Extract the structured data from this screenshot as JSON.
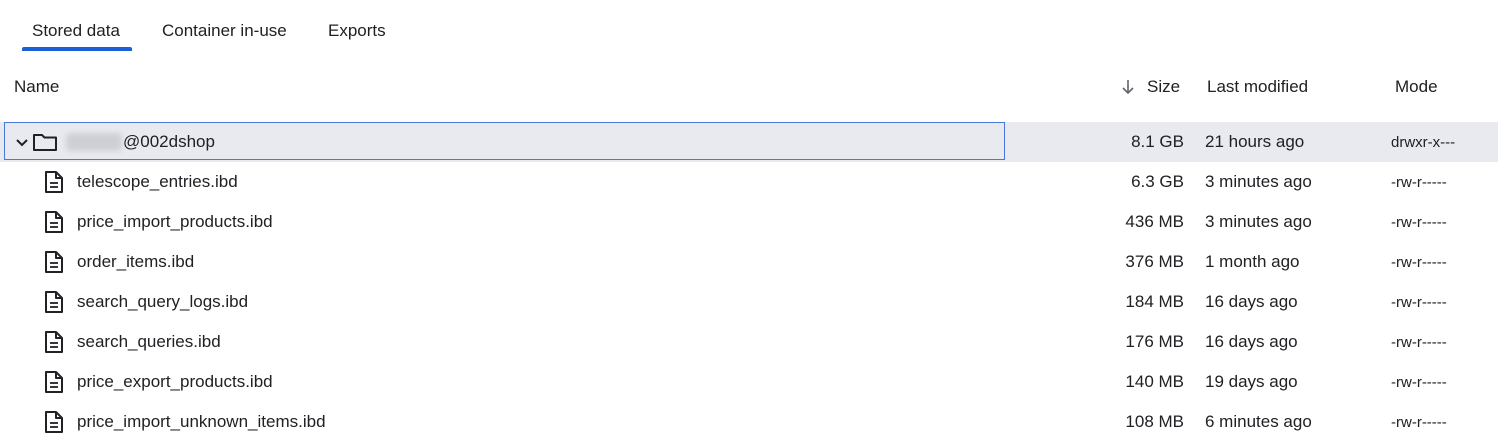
{
  "tabs": [
    {
      "label": "Stored data",
      "active": true
    },
    {
      "label": "Container in-use",
      "active": false
    },
    {
      "label": "Exports",
      "active": false
    }
  ],
  "columns": {
    "name": "Name",
    "size": "Size",
    "last_modified": "Last modified",
    "mode": "Mode"
  },
  "folder": {
    "name": "@002dshop",
    "size": "8.1 GB",
    "modified": "21 hours ago",
    "mode": "drwxr-x---",
    "expanded": true
  },
  "files": [
    {
      "name": "telescope_entries.ibd",
      "size": "6.3 GB",
      "modified": "3 minutes ago",
      "mode": "-rw-r-----"
    },
    {
      "name": "price_import_products.ibd",
      "size": "436 MB",
      "modified": "3 minutes ago",
      "mode": "-rw-r-----"
    },
    {
      "name": "order_items.ibd",
      "size": "376 MB",
      "modified": "1 month ago",
      "mode": "-rw-r-----"
    },
    {
      "name": "search_query_logs.ibd",
      "size": "184 MB",
      "modified": "16 days ago",
      "mode": "-rw-r-----"
    },
    {
      "name": "search_queries.ibd",
      "size": "176 MB",
      "modified": "16 days ago",
      "mode": "-rw-r-----"
    },
    {
      "name": "price_export_products.ibd",
      "size": "140 MB",
      "modified": "19 days ago",
      "mode": "-rw-r-----"
    },
    {
      "name": "price_import_unknown_items.ibd",
      "size": "108 MB",
      "modified": "6 minutes ago",
      "mode": "-rw-r-----"
    }
  ],
  "colors": {
    "accent": "#1a5fd6",
    "selected_row": "#e8eaef",
    "focus_border": "#4a78d8"
  },
  "icons": {
    "sort": "arrow-down-icon",
    "expand": "chevron-down-icon",
    "folder": "folder-icon",
    "file": "file-icon"
  }
}
